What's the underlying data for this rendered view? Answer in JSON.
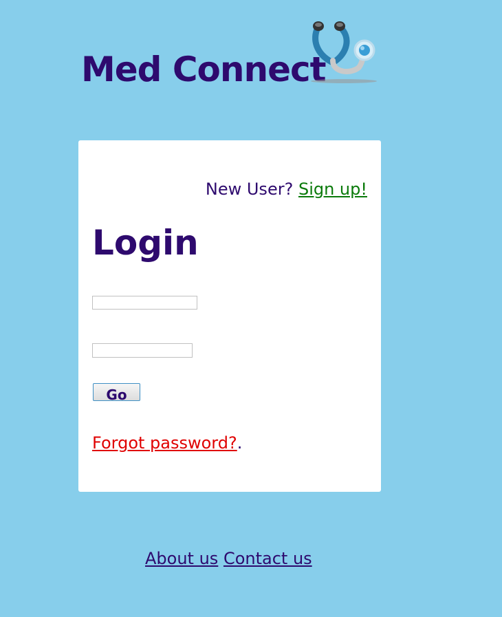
{
  "header": {
    "title": "Med Connect",
    "logo_icon": "stethoscope-icon"
  },
  "login_card": {
    "new_user_prompt": "New User?",
    "signup_link": "Sign up!",
    "heading": "Login",
    "username_value": "",
    "password_value": "",
    "go_button": "Go",
    "forgot_link": "Forgot password?",
    "forgot_suffix": "."
  },
  "footer": {
    "about_link": "About us",
    "contact_link": "Contact us"
  },
  "colors": {
    "background": "#87ceeb",
    "brand_text": "#2e0a6e",
    "signup_link": "#0a7a0a",
    "forgot_link": "#e00000",
    "card": "#ffffff"
  }
}
